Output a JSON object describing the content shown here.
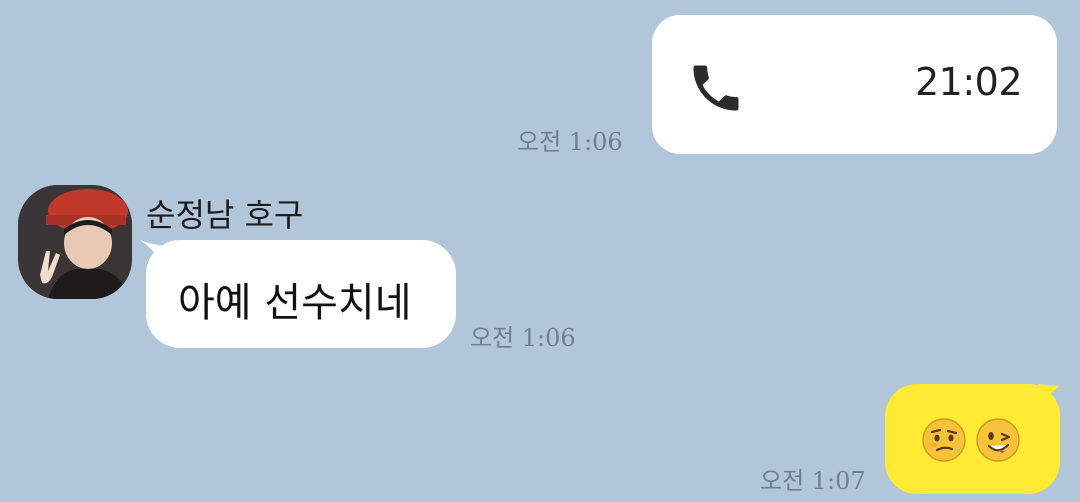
{
  "messages": {
    "call": {
      "icon": "phone-icon",
      "duration": "21:02",
      "time": "오전 1:06"
    },
    "incoming": {
      "sender": "순정남 호구",
      "avatar": "profile-photo",
      "text": "아예 선수치네",
      "time": "오전 1:06"
    },
    "outgoing": {
      "emojis": [
        "confused-face-emoji",
        "winking-face-emoji"
      ],
      "time": "오전 1:07"
    }
  },
  "colors": {
    "background": "#b2c6da",
    "my_bubble": "#ffeb33",
    "other_bubble": "#ffffff",
    "time_text": "#6f7f8e"
  }
}
